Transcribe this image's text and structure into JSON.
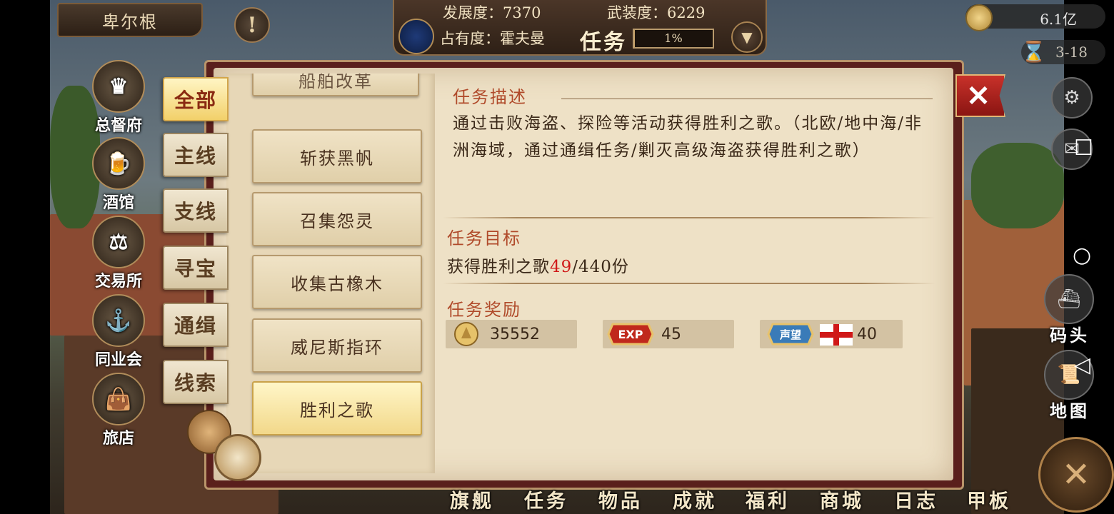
{
  "header": {
    "location": "卑尔根",
    "development": "发展度：7370",
    "armament": "武装度：6229",
    "occupancy": "占有度：霍夫曼",
    "title": "任务",
    "progress_text": "1%",
    "progress_value": 0.01
  },
  "resources": {
    "money": "6.1亿",
    "date": "3-18"
  },
  "left_nav": [
    {
      "label": "总督府",
      "icon": "crown-icon"
    },
    {
      "label": "酒馆",
      "icon": "beer-mug-icon"
    },
    {
      "label": "交易所",
      "icon": "scales-icon"
    },
    {
      "label": "同业会",
      "icon": "shield-anchor-icon"
    },
    {
      "label": "旅店",
      "icon": "bag-icon"
    }
  ],
  "tabs": [
    {
      "label": "全部",
      "active": true
    },
    {
      "label": "主线",
      "active": false
    },
    {
      "label": "支线",
      "active": false
    },
    {
      "label": "寻宝",
      "active": false
    },
    {
      "label": "通缉",
      "active": false
    },
    {
      "label": "线索",
      "active": false
    }
  ],
  "task_list": [
    {
      "label": "船舶改革",
      "active": false
    },
    {
      "label": "斩获黑帆",
      "active": false
    },
    {
      "label": "召集怨灵",
      "active": false
    },
    {
      "label": "收集古橡木",
      "active": false
    },
    {
      "label": "威尼斯指环",
      "active": false
    },
    {
      "label": "胜利之歌",
      "active": true
    }
  ],
  "detail": {
    "desc_title": "任务描述",
    "desc_text": "通过击败海盗、探险等活动获得胜利之歌。（北欧/地中海/非洲海域，通过通缉任务/剿灭高级海盗获得胜利之歌）",
    "goal_title": "任务目标",
    "goal_prefix": "获得胜利之歌",
    "goal_current": "49",
    "goal_suffix": "/440份",
    "reward_title": "任务奖励",
    "rewards": [
      {
        "icon": "gold-coin-icon",
        "value": "35552"
      },
      {
        "icon": "exp-badge-icon",
        "value": "45",
        "badge": "EXP"
      },
      {
        "icon": "reputation-badge-icon",
        "value": "40",
        "badge": "声望"
      }
    ]
  },
  "close_label": "✕",
  "right_nav": [
    {
      "label": "码头"
    },
    {
      "label": "地图"
    }
  ],
  "bottom_nav": [
    "旗舰",
    "任务",
    "物品",
    "成就",
    "福利",
    "商城",
    "日志",
    "甲板"
  ],
  "colors": {
    "accent_red": "#b04a2a",
    "goal_red": "#d01818",
    "panel_border": "#5a1f1c"
  }
}
